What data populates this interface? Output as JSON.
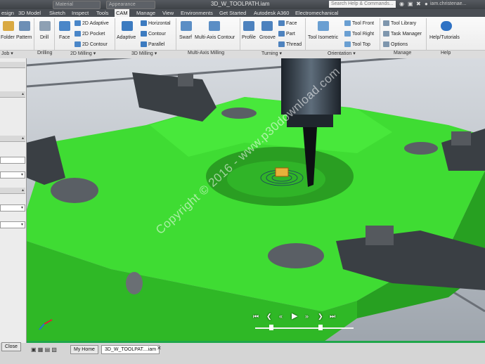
{
  "title_bar": {
    "material": "Material",
    "appearance": "Appearance",
    "document": "3D_W_TOOLPATH.iam",
    "search_placeholder": "Search Help & Commands...",
    "user": "iam.christenae..."
  },
  "tabs": [
    "esign",
    "3D Model",
    "Sketch",
    "Inspect",
    "Tools",
    "CAM",
    "Manage",
    "View",
    "Environments",
    "Get Started",
    "Autodesk A360",
    "Electromechanical"
  ],
  "active_tab": "CAM",
  "ribbon": {
    "job": {
      "folder": "Folder",
      "pattern": "Pattern",
      "label": "Job"
    },
    "drilling": {
      "drill": "Drill",
      "label": "Drilling"
    },
    "milling2d": {
      "face": "Face",
      "adaptive": "2D Adaptive",
      "pocket": "2D Pocket",
      "contour": "2D Contour",
      "label": "2D Milling"
    },
    "milling3d": {
      "adaptive": "Adaptive",
      "horizontal": "Horizontal",
      "contour": "Contour",
      "parallel": "Parallel",
      "label": "3D Milling"
    },
    "multiaxis": {
      "swarf": "Swarf",
      "contour": "Multi-Axis Contour",
      "label": "Multi-Axis Milling"
    },
    "turning": {
      "profile": "Profile",
      "groove": "Groove",
      "face": "Face",
      "part": "Part",
      "thread": "Thread",
      "label": "Turning"
    },
    "orientation": {
      "isometric": "Tool Isometric",
      "front": "Tool Front",
      "right": "Tool Right",
      "top": "Tool Top",
      "label": "Orientation"
    },
    "manage": {
      "library": "Tool Library",
      "task": "Task Manager",
      "options": "Options",
      "label": "Manage"
    },
    "help": {
      "tutorials": "Help/Tutorials",
      "label": "Help"
    }
  },
  "left_panel": {
    "close": "Close"
  },
  "doc_tabs": [
    "My Home",
    "3D_W_TOOLPAT....iam"
  ],
  "watermark": "Copyright © 2016 - www.p30download.com",
  "colors": {
    "part": "#3fdc33",
    "tabs_bg": "#4b4f55",
    "ribbon": "#f0f0f0"
  }
}
